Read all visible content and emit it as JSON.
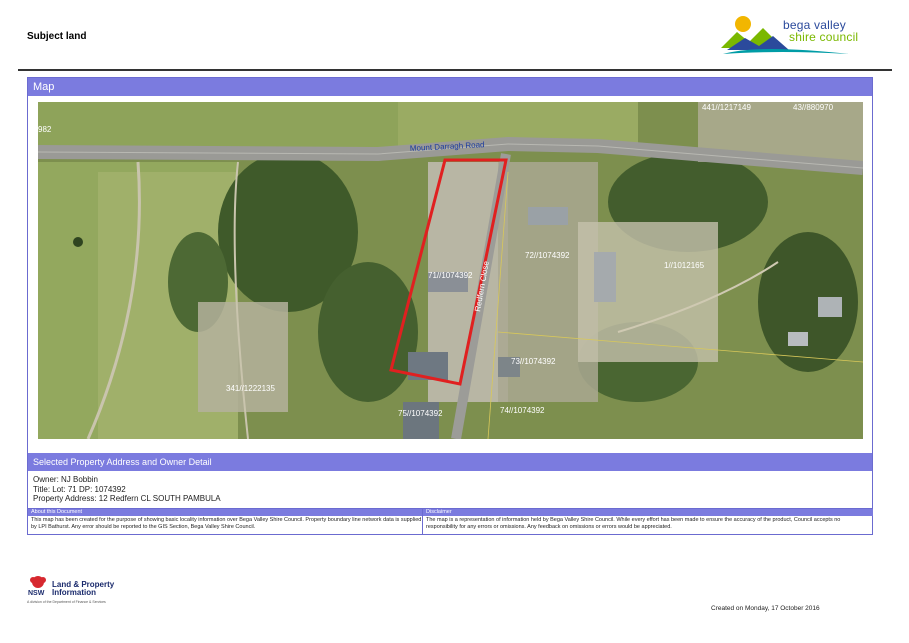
{
  "page": {
    "title": "Subject land"
  },
  "logo": {
    "line1": "bega valley",
    "line2": "shire council",
    "colors": {
      "navy": "#2b4a9c",
      "green": "#7ab800",
      "sun": "#f2b600",
      "teal": "#009ca6"
    }
  },
  "map_section": {
    "heading": "Map",
    "road_name": "Mount Darragh Road",
    "street_name": "Redfern Close",
    "lots": [
      {
        "id": "lot-982",
        "label": "982"
      },
      {
        "id": "lot-441",
        "label": "441//1217149"
      },
      {
        "id": "lot-43",
        "label": "43//880970"
      },
      {
        "id": "lot-71",
        "label": "71//1074392"
      },
      {
        "id": "lot-72",
        "label": "72//1074392"
      },
      {
        "id": "lot-1",
        "label": "1//1012165"
      },
      {
        "id": "lot-73",
        "label": "73//1074392"
      },
      {
        "id": "lot-74",
        "label": "74//1074392"
      },
      {
        "id": "lot-75",
        "label": "75//1074392"
      },
      {
        "id": "lot-341",
        "label": "341//1222135"
      }
    ],
    "highlight_color": "#e02020"
  },
  "detail_section": {
    "heading": "Selected Property Address and Owner Detail",
    "owner": "Owner: NJ Bobbin",
    "title": "Title: Lot: 71 DP: 1074392",
    "address": "Property Address: 12 Redfern CL   SOUTH PAMBULA"
  },
  "notes": {
    "about_heading": "About this Document",
    "about_text": "This map has been created for the purpose of showing basic locality information over Bega Valley Shire Council. Property boundary line network data is supplied by LPI Bathurst. Any error should be reported to the GIS Section, Bega Valley Shire Council.",
    "disclaimer_heading": "Disclaimer",
    "disclaimer_text": "The map is a representation of information held by Bega Valley Shire Council. While every effort has been made to ensure the accuracy of the product, Council accepts no responsibility for any errors or omissions. Any feedback on omissions or errors would be appreciated."
  },
  "footer": {
    "nsw": "NSW",
    "lpi_line1": "Land & Property",
    "lpi_line2": "Information",
    "lpi_sub": "A division of the Department of Finance & Services",
    "created": "Created on Monday, 17 October 2016"
  }
}
